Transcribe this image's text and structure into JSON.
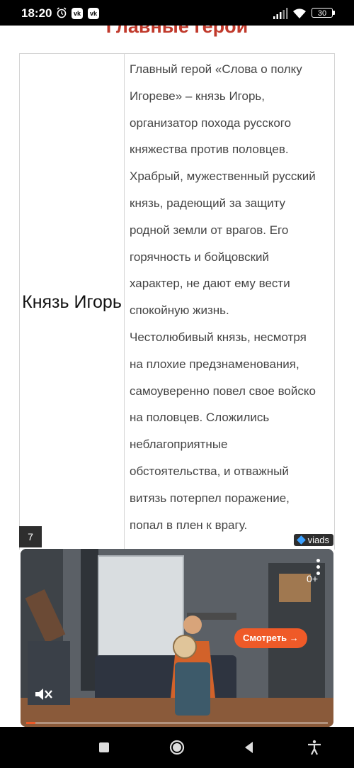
{
  "status_bar": {
    "time": "18:20",
    "notification_icons": [
      "alarm-icon",
      "vk-icon",
      "vk-icon"
    ],
    "vk_label": "vk",
    "battery": "30"
  },
  "section_title": "Главные герои",
  "table": {
    "name": "Князь Игорь",
    "description_lines": [
      "Главный герой «Слова о полку",
      "Игореве» – князь Игорь,",
      "организатор похода русского",
      "княжества против половцев.",
      "Храбрый, мужественный русский",
      "князь, радеющий за защиту",
      "родной земли от врагов. Его",
      "горячность и бойцовский",
      "характер, не дают ему вести",
      "спокойную жизнь.",
      "Честолюбивый князь, несмотря",
      "на плохие предзнаменования,",
      "самоуверенно повел свое войско",
      "на половцев. Сложились",
      "неблагоприятные",
      "обстоятельства, и отважный",
      "витязь потерпел поражение,",
      "попал в плен к врагу."
    ]
  },
  "ad": {
    "number": "7",
    "brand": "viads",
    "age_rating": "0+",
    "cta": "Смотреть →",
    "progress": 0.03
  },
  "colors": {
    "accent_red": "#c0392b",
    "cta_orange": "#ef5a28",
    "viads_gem": "#3aa0ff"
  },
  "nav_bar": [
    "recent-apps-icon",
    "home-icon",
    "back-icon",
    "accessibility-icon"
  ]
}
